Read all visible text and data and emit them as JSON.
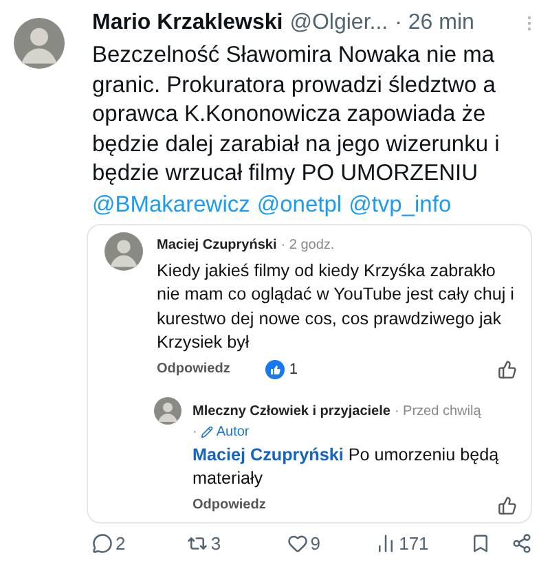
{
  "tweet": {
    "author": "Mario Krzaklewski",
    "handle": "@Olgier...",
    "time": "· 26 min",
    "text": "Bezczelność Sławomira Nowaka nie ma granic. Prokuratora prowadzi śledztwo a oprawca K.Kononowicza zapowiada że będzie dalej zarabiał na jego wizerunku i będzie wrzucał filmy PO UMORZENIU",
    "mentions": [
      "@BMakarewicz",
      "@onetpl",
      "@tvp_info"
    ]
  },
  "comment": {
    "author": "Maciej Czupryński",
    "time": "· 2 godz.",
    "text": "Kiedy jakieś filmy od kiedy Krzyśka zabrakło nie mam co oglądać w YouTube jest cały chuj i kurestwo dej nowe cos, cos prawdziwego jak Krzysiek był",
    "reply_label": "Odpowiedz",
    "reactions": "1",
    "reply": {
      "author": "Mleczny Człowiek i przyjaciele",
      "time": "· Przed chwilą",
      "badge_sep": "·",
      "badge": "Autor",
      "mention": "Maciej Czupryński",
      "text": "Po umorzeniu będą materiały",
      "reply_label": "Odpowiedz"
    }
  },
  "actions": [
    {
      "kind": "reply",
      "count": "2"
    },
    {
      "kind": "retweet",
      "count": "3"
    },
    {
      "kind": "like",
      "count": "9"
    },
    {
      "kind": "views",
      "count": "171"
    },
    {
      "kind": "bookmark"
    },
    {
      "kind": "share"
    }
  ]
}
